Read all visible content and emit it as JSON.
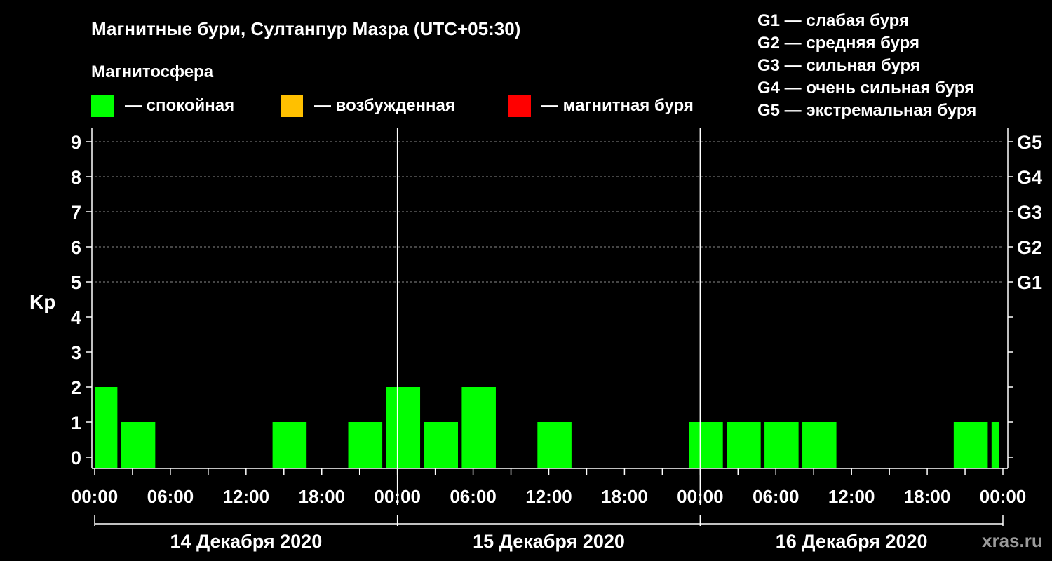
{
  "chart_data": {
    "type": "bar",
    "title": "Магнитные бури, Султанпур Мазра (UTC+05:30)",
    "subtitle": "Магнитосфера",
    "legend": [
      {
        "color": "#00ff00",
        "label": "— спокойная"
      },
      {
        "color": "#ffc000",
        "label": "— возбужденная"
      },
      {
        "color": "#ff0000",
        "label": "— магнитная буря"
      }
    ],
    "g_scale": [
      "G1 — слабая буря",
      "G2 — средняя буря",
      "G3 — сильная буря",
      "G4 — очень сильная буря",
      "G5 — экстремальная буря"
    ],
    "ylabel": "Kp",
    "ylim": [
      0,
      9
    ],
    "yticks": [
      "0",
      "1",
      "2",
      "3",
      "4",
      "5",
      "6",
      "7",
      "8",
      "9"
    ],
    "right_ticks": [
      {
        "kp": 5,
        "label": "G1"
      },
      {
        "kp": 6,
        "label": "G2"
      },
      {
        "kp": 7,
        "label": "G3"
      },
      {
        "kp": 8,
        "label": "G4"
      },
      {
        "kp": 9,
        "label": "G5"
      }
    ],
    "x_range_hours": [
      0,
      72
    ],
    "xtick_labels": [
      "00:00",
      "06:00",
      "12:00",
      "18:00",
      "00:00",
      "06:00",
      "12:00",
      "18:00",
      "00:00",
      "06:00",
      "12:00",
      "18:00",
      "00:00"
    ],
    "days": [
      "14 Декабря 2020",
      "15 Декабря 2020",
      "16 Декабря 2020"
    ],
    "grid": "horizontal dashed at 5–9",
    "series": [
      {
        "bars": [
          {
            "start": 0,
            "end": 1.8,
            "kp": 2
          },
          {
            "start": 2.1,
            "end": 4.8,
            "kp": 1
          },
          {
            "start": 14.1,
            "end": 16.8,
            "kp": 1
          },
          {
            "start": 20.1,
            "end": 22.8,
            "kp": 1
          },
          {
            "start": 23.1,
            "end": 25.8,
            "kp": 2
          },
          {
            "start": 26.1,
            "end": 28.8,
            "kp": 1
          },
          {
            "start": 29.1,
            "end": 31.8,
            "kp": 2
          },
          {
            "start": 35.1,
            "end": 37.8,
            "kp": 1
          },
          {
            "start": 47.1,
            "end": 49.8,
            "kp": 1
          },
          {
            "start": 50.1,
            "end": 52.8,
            "kp": 1
          },
          {
            "start": 53.1,
            "end": 55.8,
            "kp": 1
          },
          {
            "start": 56.1,
            "end": 58.8,
            "kp": 1
          },
          {
            "start": 68.1,
            "end": 70.8,
            "kp": 1
          },
          {
            "start": 71.1,
            "end": 71.7,
            "kp": 1
          }
        ]
      }
    ]
  },
  "watermark": "xras.ru"
}
